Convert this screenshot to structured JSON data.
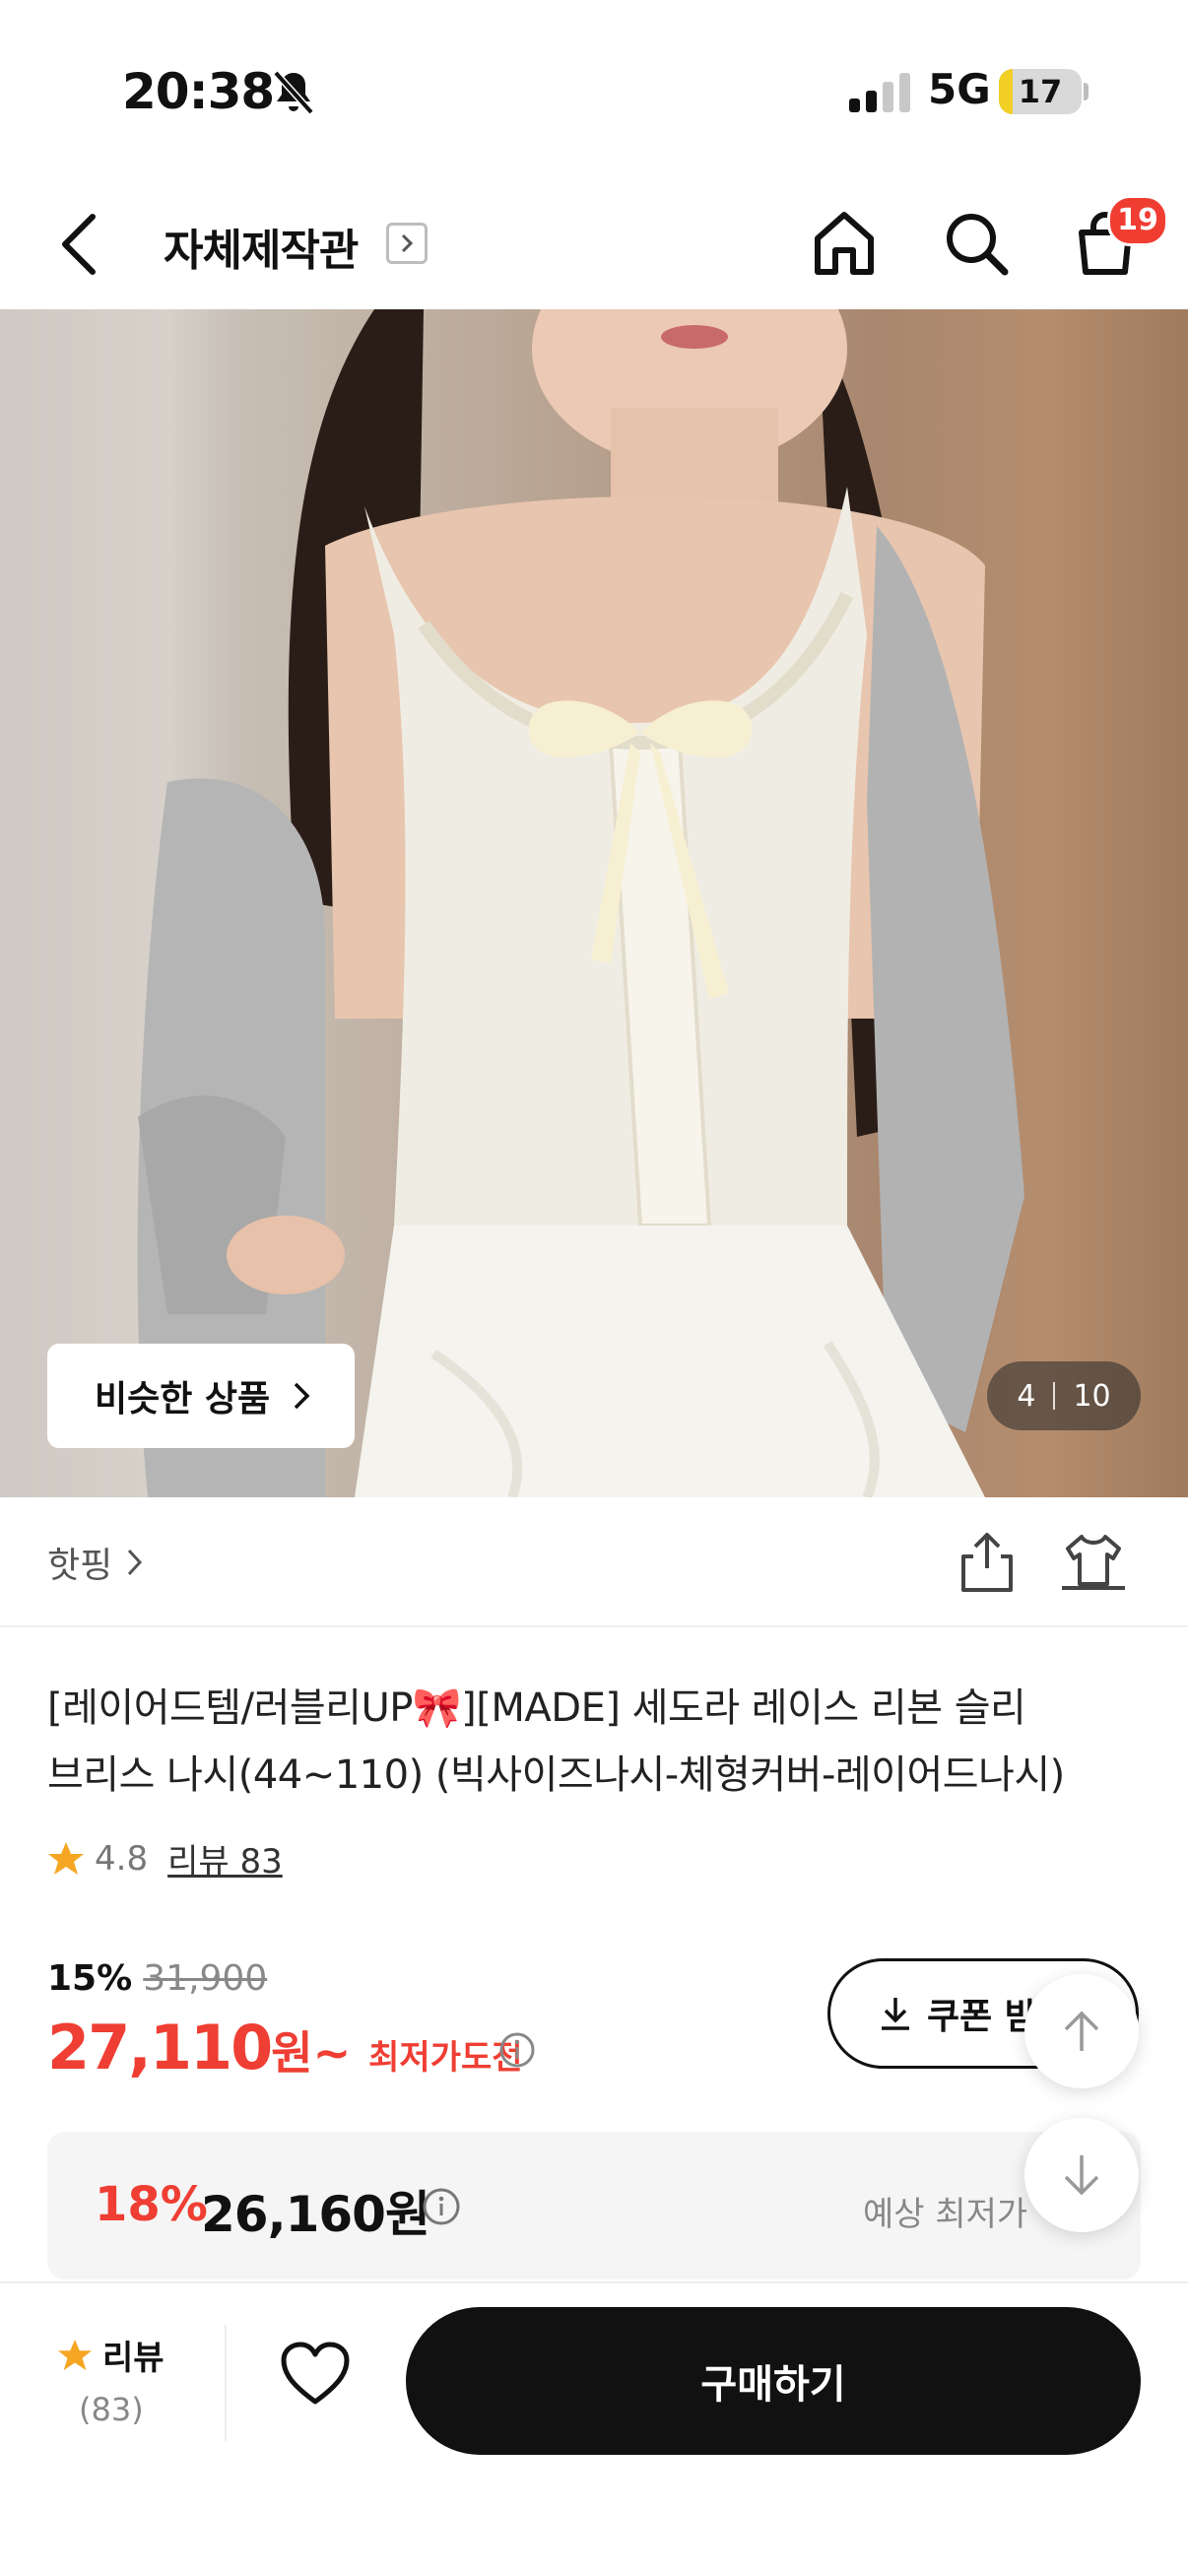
{
  "status_bar": {
    "time": "20:38",
    "network": "5G",
    "battery": "17",
    "battery_fraction": 0.17
  },
  "nav": {
    "title": "자체제작관",
    "cart_count": "19"
  },
  "gallery": {
    "similar_label": "비슷한 상품",
    "current": "4",
    "total": "10"
  },
  "brand": {
    "name": "핫핑"
  },
  "product": {
    "title_line1": " [레이어드템/러블리UP🎀][MADE] 세도라 레이스 리본 슬리",
    "title_line2": "브리스 나시(44~110) (빅사이즈나시-체형커버-레이어드나시)",
    "rating": "4.8",
    "review_link": "리뷰 83"
  },
  "price": {
    "discount": "15%",
    "original": "31,900",
    "sale": "27,110",
    "sale_unit": "원~",
    "lowest_tag": "최저가도전",
    "coupon_label": "쿠폰 받기"
  },
  "expected": {
    "pct": "18%",
    "price": "26,160원",
    "label": "예상 최저가"
  },
  "bottom": {
    "review_label": "리뷰",
    "review_count": "(83)",
    "buy_label": "구매하기"
  },
  "colors": {
    "accent_red": "#ef3e33",
    "star": "#f5a623",
    "dark": "#111111"
  }
}
